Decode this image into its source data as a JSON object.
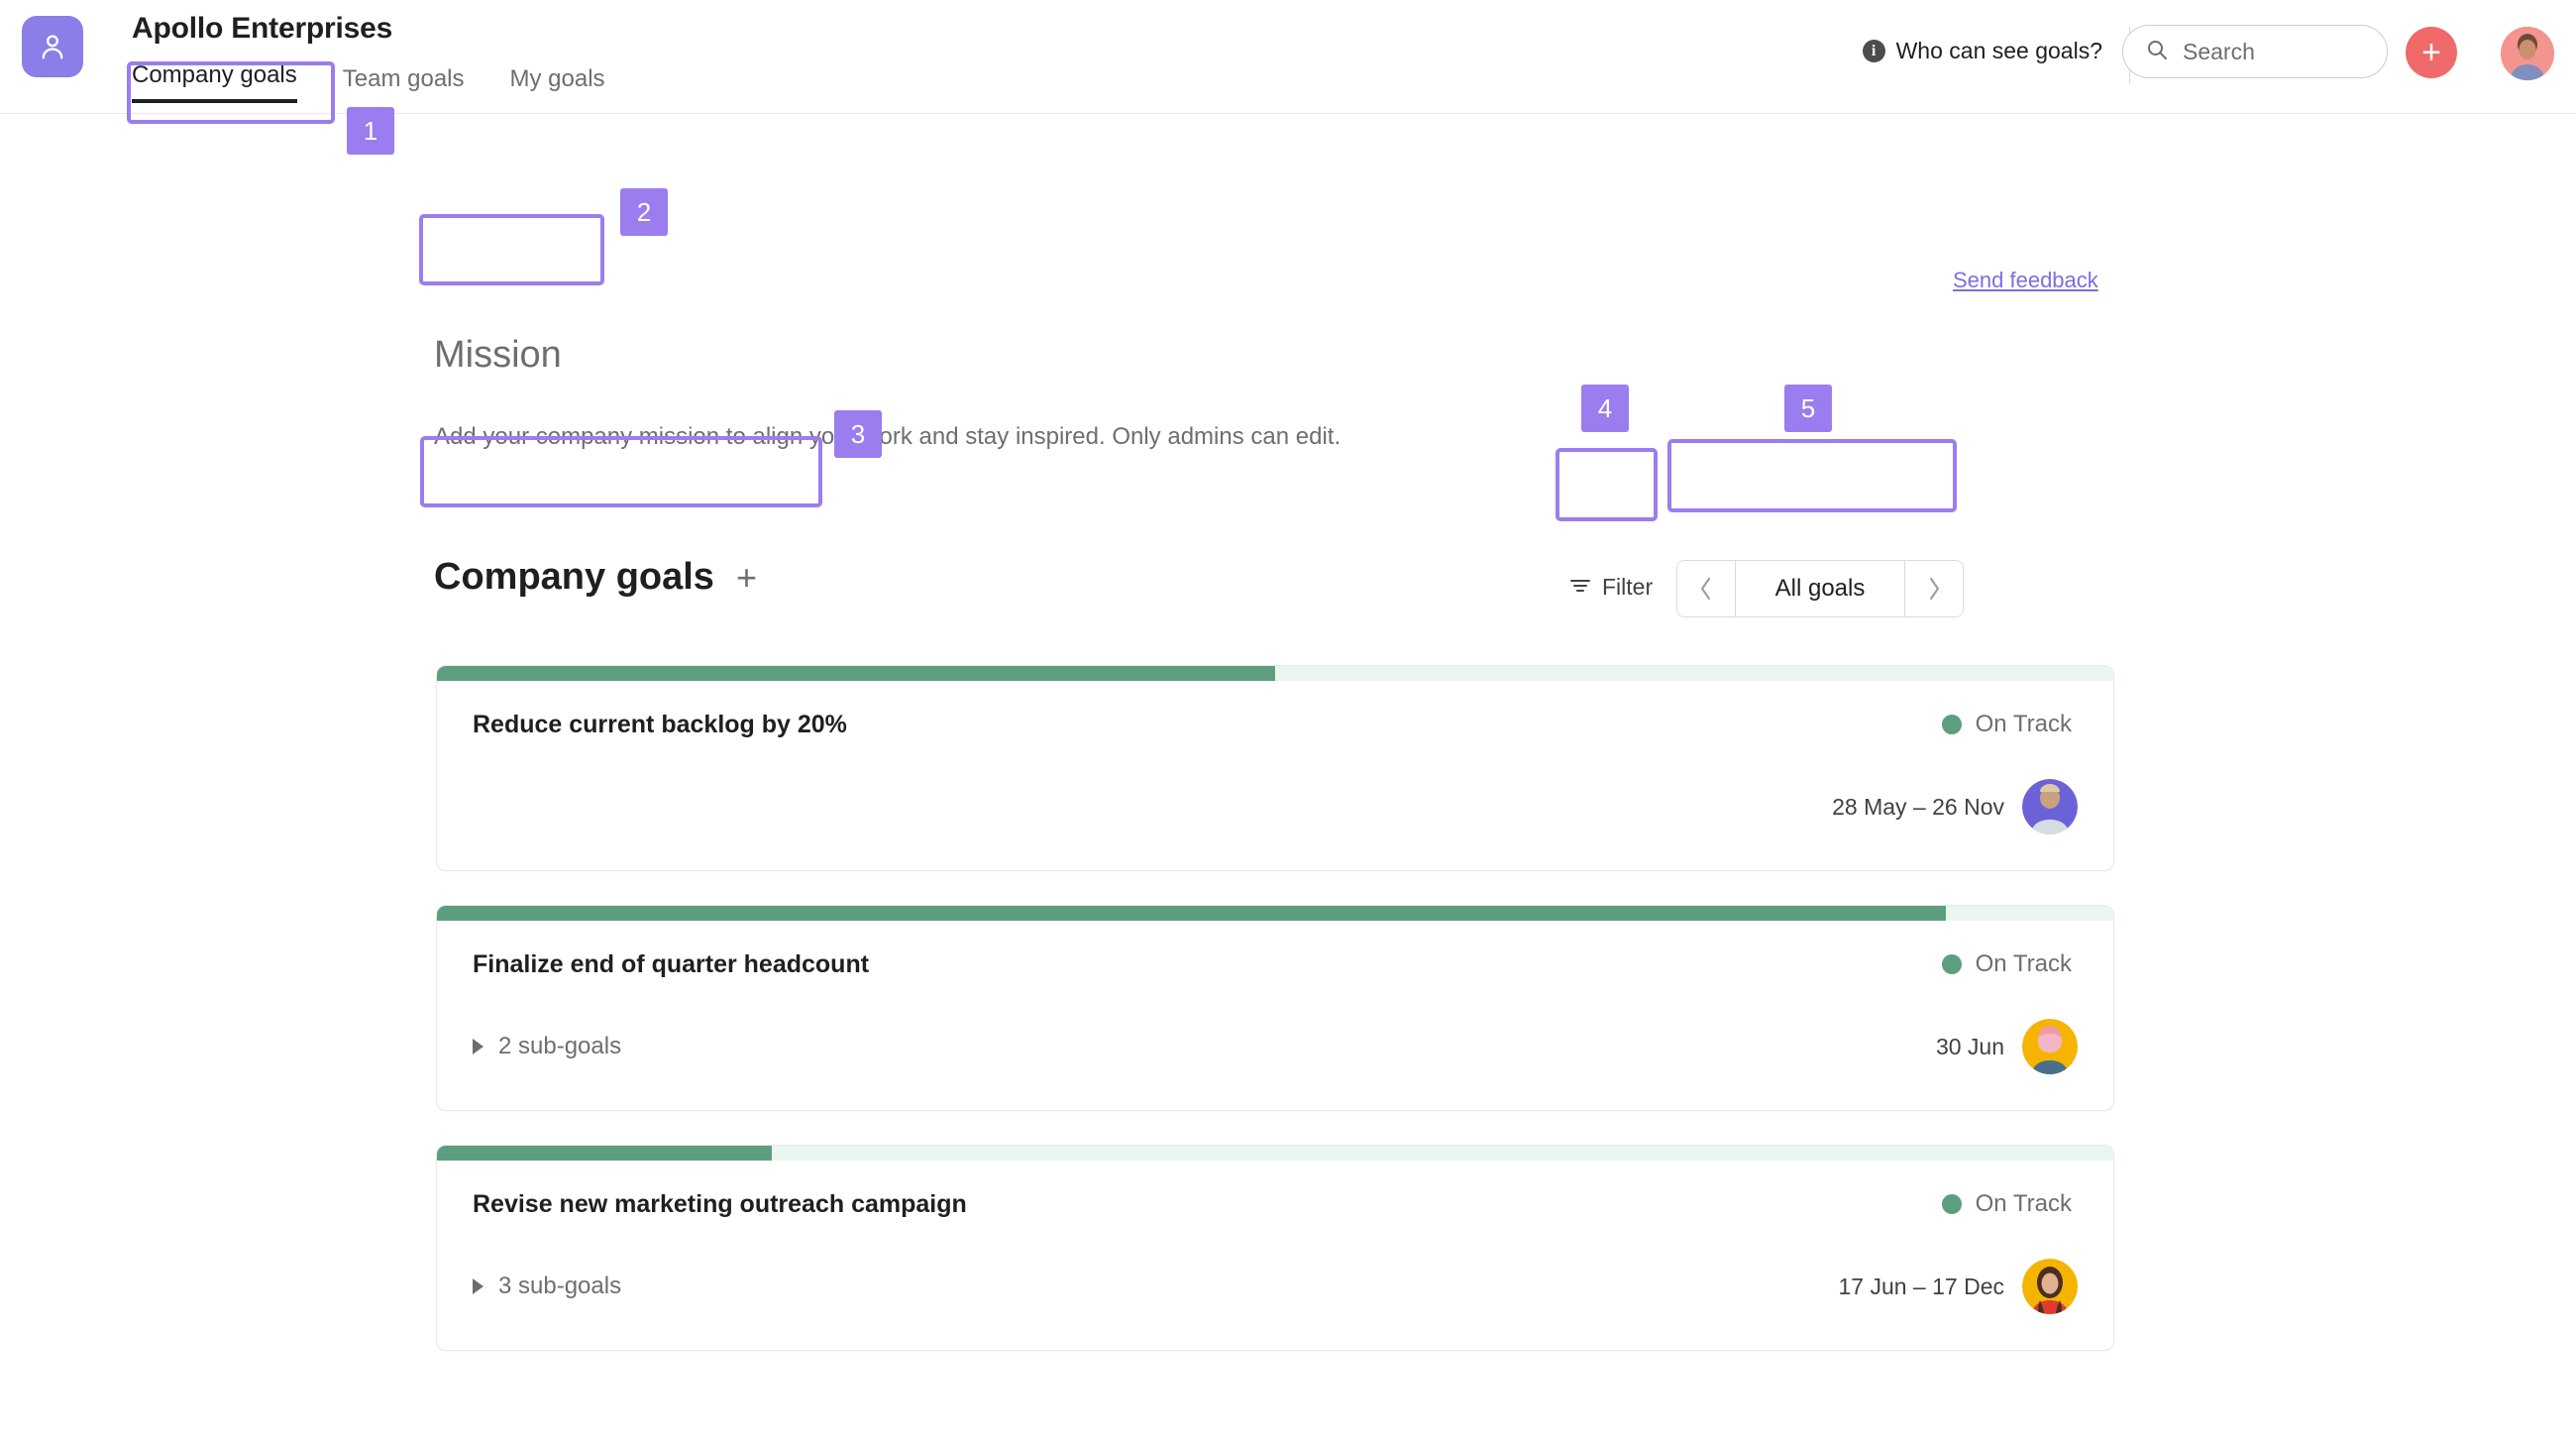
{
  "header": {
    "logo_icon": "user-avatar-logo-icon",
    "brand_title": "Apollo Enterprises",
    "tabs": [
      {
        "label": "Company goals",
        "active": true
      },
      {
        "label": "Team goals",
        "active": false
      },
      {
        "label": "My goals",
        "active": false
      }
    ],
    "who_can_see": "Who can see goals?",
    "info_glyph": "i",
    "search": {
      "placeholder": "Search",
      "value": "",
      "icon": "search-icon"
    },
    "create_button": {
      "label": "+",
      "color": "#f06a6a"
    },
    "profile_avatar": "user-profile-avatar"
  },
  "content": {
    "send_feedback": "Send feedback",
    "mission": {
      "title": "Mission",
      "description": "Add your company mission to align your work and stay inspired. Only admins can edit."
    },
    "section": {
      "title": "Company goals",
      "add_glyph": "+"
    },
    "filter": {
      "label": "Filter",
      "icon": "filter-icon"
    },
    "goal_switcher": {
      "prev_glyph": "‹",
      "next_glyph": "›",
      "current": "All goals"
    }
  },
  "goals": [
    {
      "name": "Reduce current backlog by 20%",
      "status": "On Track",
      "status_color": "#5c9e7f",
      "progress_percent": 50,
      "sub_goals": null,
      "dates": "28 May – 26 Nov",
      "owner_avatar_bg": "#6c62d8"
    },
    {
      "name": "Finalize end of quarter headcount",
      "status": "On Track",
      "status_color": "#5c9e7f",
      "progress_percent": 90,
      "sub_goals": "2 sub-goals",
      "dates": "30 Jun",
      "owner_avatar_bg": "#f5b400"
    },
    {
      "name": "Revise new marketing outreach campaign",
      "status": "On Track",
      "status_color": "#5c9e7f",
      "progress_percent": 20,
      "sub_goals": "3 sub-goals",
      "dates": "17 Jun – 17 Dec",
      "owner_avatar_bg": "#f5b400"
    }
  ],
  "annotations": [
    {
      "number": "1"
    },
    {
      "number": "2"
    },
    {
      "number": "3"
    },
    {
      "number": "4"
    },
    {
      "number": "5"
    }
  ],
  "colors": {
    "accent_purple": "#8a7ee8",
    "annotation_purple": "#9b7df0",
    "progress_green": "#5c9e7f",
    "progress_track": "#e9f6ef",
    "create_red": "#f06a6a",
    "link_purple": "#7c6ee0"
  }
}
